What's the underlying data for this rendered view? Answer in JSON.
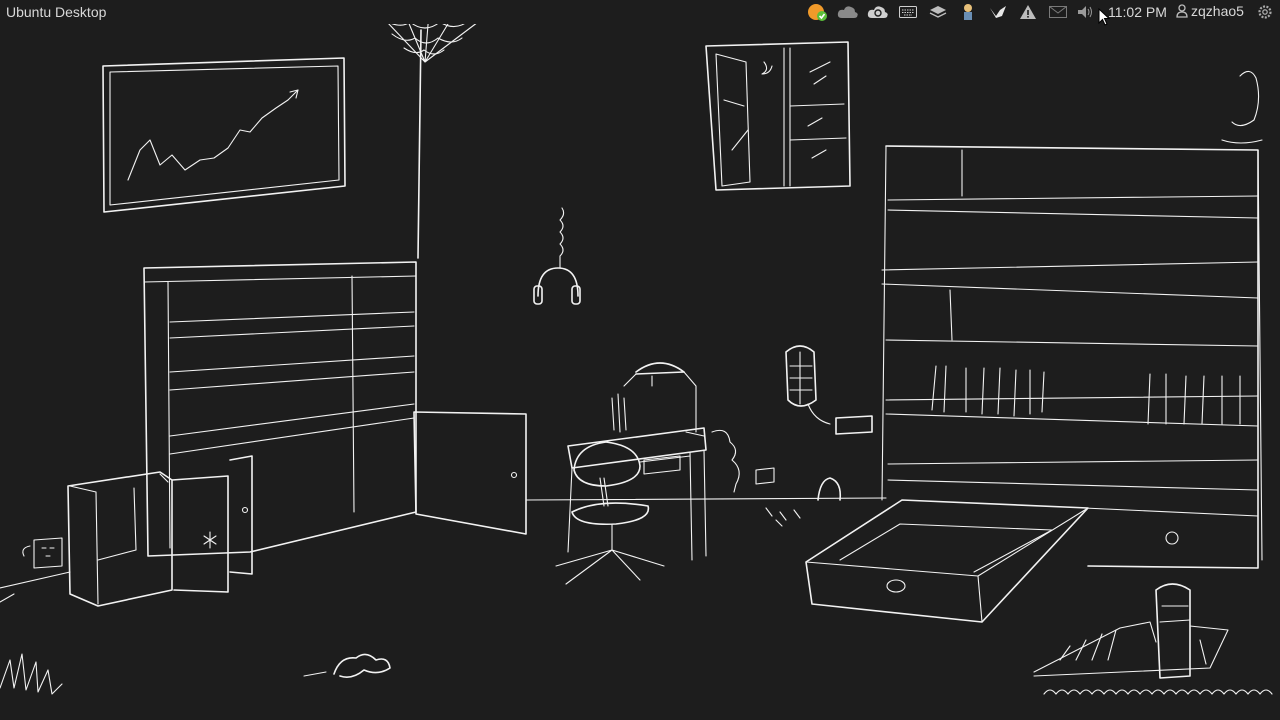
{
  "topbar": {
    "app_title": "Ubuntu Desktop",
    "clock": "11:02 PM",
    "username": "zqzhao5"
  },
  "tray_icons": [
    "notification-update-icon",
    "cloud-icon",
    "cloud-sync-icon",
    "keyboard-icon",
    "dropbox-icon",
    "user-figure-icon",
    "crane-icon",
    "alert-icon",
    "mail-icon",
    "volume-icon"
  ],
  "colors": {
    "background": "#1d1d1d",
    "sketch_line": "#f2f2f2",
    "panel_text": "#d8d8d8",
    "update_badge": "#f09a2a",
    "update_check": "#5bbf3a"
  },
  "wallpaper": {
    "style": "hand-drawn white line sketch of a room on black"
  }
}
